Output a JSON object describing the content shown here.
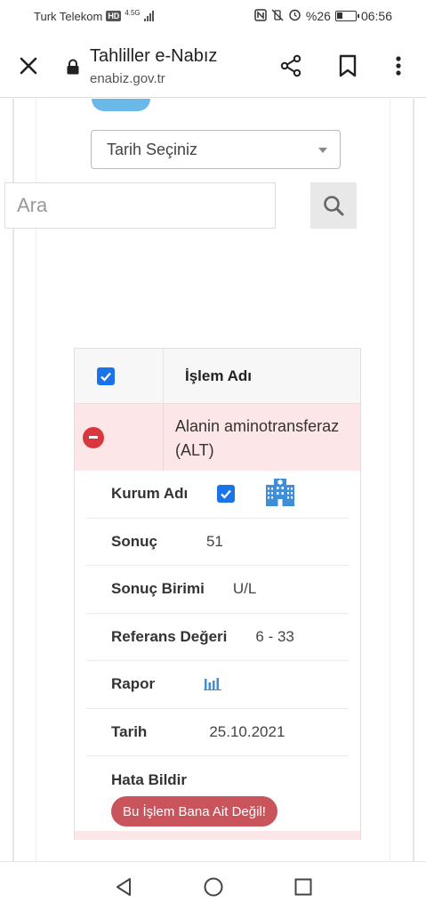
{
  "status_bar": {
    "carrier": "Turk Telekom",
    "hd_badge": "HD",
    "network": "4.5G",
    "battery_text": "%26",
    "time": "06:56"
  },
  "browser": {
    "title": "Tahliller e-Nabız",
    "url": "enabiz.gov.tr"
  },
  "filters": {
    "date_select_label": "Tarih Seçiniz",
    "search_placeholder": "Ara"
  },
  "table": {
    "header_name": "İşlem Adı",
    "header_checked": true,
    "row": {
      "name": "Alanin aminotransferaz (ALT)",
      "expanded": true,
      "details": {
        "institution_label": "Kurum Adı",
        "institution_checked": true,
        "result_label": "Sonuç",
        "result_value": "51",
        "unit_label": "Sonuç Birimi",
        "unit_value": "U/L",
        "reference_label": "Referans Değeri",
        "reference_value": "6 - 33",
        "report_label": "Rapor",
        "date_label": "Tarih",
        "date_value": "25.10.2021",
        "report_error_label": "Hata Bildir",
        "report_error_button": "Bu İşlem Bana Ait Değil!"
      }
    }
  },
  "colors": {
    "accent": "#1a73e8",
    "row_highlight": "#fde6e8",
    "danger": "#d9363e",
    "report_button": "#c9545b",
    "building_icon": "#3f8fd8"
  },
  "icons": {
    "close": "close-icon",
    "lock": "lock-icon",
    "share": "share-icon",
    "bookmark": "bookmark-icon",
    "more": "more-vertical-icon",
    "search": "search-icon",
    "building": "building-icon",
    "chart": "bar-chart-icon"
  }
}
